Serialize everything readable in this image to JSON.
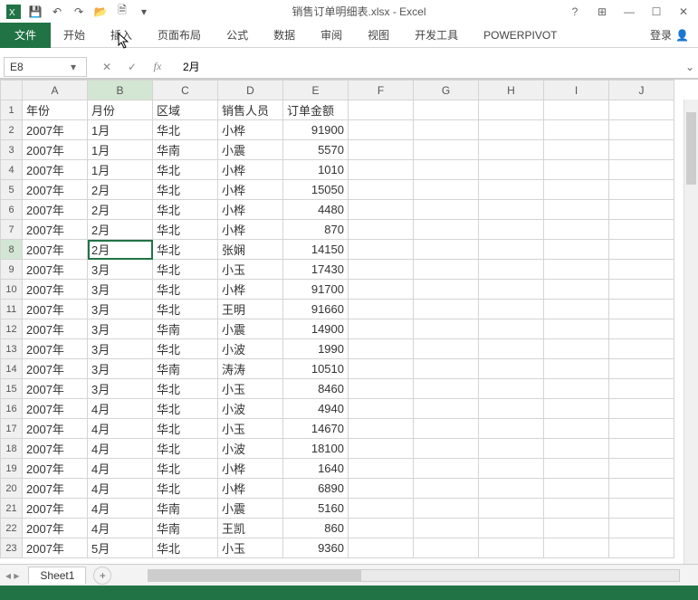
{
  "app": {
    "title": "销售订单明细表.xlsx - Excel"
  },
  "qat": {
    "save": "💾",
    "undo": "↶",
    "redo": "↷",
    "open": "📂",
    "new": "🗎"
  },
  "ribbon": {
    "file": "文件",
    "tabs": [
      "开始",
      "插入",
      "页面布局",
      "公式",
      "数据",
      "审阅",
      "视图",
      "开发工具",
      "POWERPIVOT"
    ],
    "login": "登录"
  },
  "formulabar": {
    "namebox": "E8",
    "value": "2月"
  },
  "columns": [
    "A",
    "B",
    "C",
    "D",
    "E",
    "F",
    "G",
    "H",
    "I",
    "J"
  ],
  "headers_row": [
    "年份",
    "月份",
    "区域",
    "销售人员",
    "订单金额"
  ],
  "rows": [
    [
      "2007年",
      "1月",
      "华北",
      "小桦",
      "91900"
    ],
    [
      "2007年",
      "1月",
      "华南",
      "小震",
      "5570"
    ],
    [
      "2007年",
      "1月",
      "华北",
      "小桦",
      "1010"
    ],
    [
      "2007年",
      "2月",
      "华北",
      "小桦",
      "15050"
    ],
    [
      "2007年",
      "2月",
      "华北",
      "小桦",
      "4480"
    ],
    [
      "2007年",
      "2月",
      "华北",
      "小桦",
      "870"
    ],
    [
      "2007年",
      "2月",
      "华北",
      "张娴",
      "14150"
    ],
    [
      "2007年",
      "3月",
      "华北",
      "小玉",
      "17430"
    ],
    [
      "2007年",
      "3月",
      "华北",
      "小桦",
      "91700"
    ],
    [
      "2007年",
      "3月",
      "华北",
      "王明",
      "91660"
    ],
    [
      "2007年",
      "3月",
      "华南",
      "小震",
      "14900"
    ],
    [
      "2007年",
      "3月",
      "华北",
      "小波",
      "1990"
    ],
    [
      "2007年",
      "3月",
      "华南",
      "涛涛",
      "10510"
    ],
    [
      "2007年",
      "3月",
      "华北",
      "小玉",
      "8460"
    ],
    [
      "2007年",
      "4月",
      "华北",
      "小波",
      "4940"
    ],
    [
      "2007年",
      "4月",
      "华北",
      "小玉",
      "14670"
    ],
    [
      "2007年",
      "4月",
      "华北",
      "小波",
      "18100"
    ],
    [
      "2007年",
      "4月",
      "华北",
      "小桦",
      "1640"
    ],
    [
      "2007年",
      "4月",
      "华北",
      "小桦",
      "6890"
    ],
    [
      "2007年",
      "4月",
      "华南",
      "小震",
      "5160"
    ],
    [
      "2007年",
      "4月",
      "华南",
      "王凯",
      "860"
    ],
    [
      "2007年",
      "5月",
      "华北",
      "小玉",
      "9360"
    ]
  ],
  "selected": {
    "cell": "B8",
    "row": 8,
    "col": "B"
  },
  "sheet": {
    "active": "Sheet1"
  }
}
